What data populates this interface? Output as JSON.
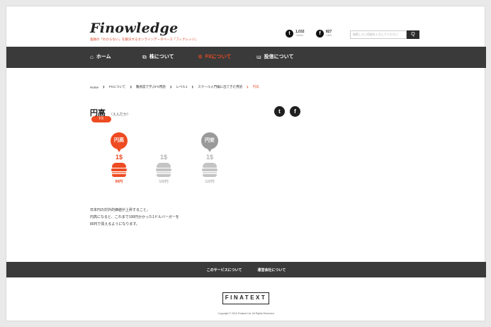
{
  "header": {
    "logo": "Finowledge",
    "tagline": "金融の「わからない」を解決するオンラインデータベース「フィナレッジ」",
    "twitter": {
      "count": "1,032",
      "label": "Tweets"
    },
    "facebook": {
      "count": "827",
      "label": "Likes"
    },
    "search_placeholder": "検索したい用語を入力してください",
    "search_button": "Q"
  },
  "nav": [
    {
      "label": "ホーム",
      "icon": "⌂"
    },
    {
      "label": "株について",
      "icon": "⧉"
    },
    {
      "label": "FXについて",
      "icon": "✲"
    },
    {
      "label": "投信について",
      "icon": "ɯ"
    }
  ],
  "breadcrumb": [
    "Home",
    "FXについて",
    "難易度で学ぶFX用語",
    "レベル1",
    "スクール入門編に出てきた用語",
    "円高"
  ],
  "term": {
    "title": "円高",
    "reading": "（えんだか）",
    "tag": "FX"
  },
  "illustration": {
    "columns": [
      {
        "bubble": "円高",
        "price": "1$",
        "yen": "80円",
        "highlight": true
      },
      {
        "bubble": "",
        "price": "1$",
        "yen": "100円",
        "highlight": false
      },
      {
        "bubble": "円安",
        "price": "1$",
        "yen": "120円",
        "highlight": false
      }
    ],
    "colors": {
      "accent": "#ee4b22",
      "muted": "#b5b5b5",
      "bubble_muted": "#9a9a9a"
    }
  },
  "description": [
    "日本円の対外的価値が上昇すること。",
    "円高になると、これまで100円かかった1ドルバーガーを",
    "80円で買えるようになります。"
  ],
  "footer": {
    "links": [
      "このサービスについて",
      "運営会社について"
    ],
    "brand": "FINATEXT",
    "copyright": "Copyright © 2016 Finatext Ltd. All Rights Reserved."
  }
}
